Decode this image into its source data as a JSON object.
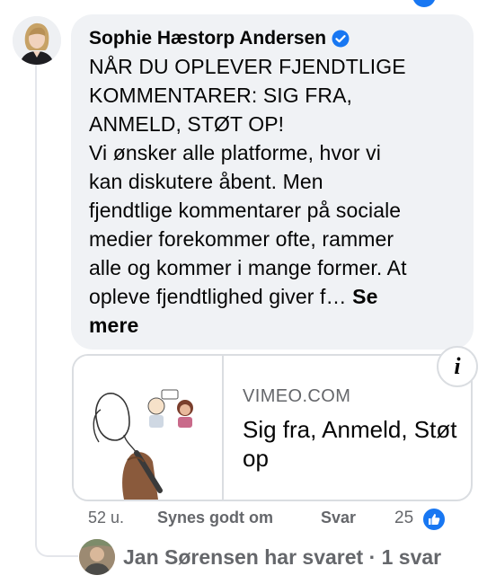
{
  "comment": {
    "author": "Sophie Hæstorp Andersen",
    "verified": true,
    "text": "NÅR DU OPLEVER FJENDTLIGE\nKOMMENTARER: SIG FRA,\nANMELD, STØT OP!\nVi ønsker alle platforme, hvor vi\nkan diskutere åbent. Men\nfjendtlige kommentarer på sociale\nmedier forekommer ofte, rammer\nalle og kommer i mange former. At\nopleve fjendtlighed giver f… ",
    "see_more": "Se\nmere"
  },
  "link_preview": {
    "domain": "VIMEO.COM",
    "title": "Sig fra, Anmeld, Støt op",
    "info_icon_label": "i"
  },
  "actions": {
    "time": "52 u.",
    "like": "Synes godt om",
    "reply": "Svar",
    "reaction_count": "25"
  },
  "replies": {
    "text": "Jan Sørensen har svaret · 1 svar"
  },
  "colors": {
    "bubble": "#f0f2f5",
    "accent": "#1877f2",
    "muted_text": "#65676b"
  },
  "icons": {
    "verified": "verified-badge-icon",
    "reaction": "like-reaction-icon",
    "info": "info-icon"
  }
}
